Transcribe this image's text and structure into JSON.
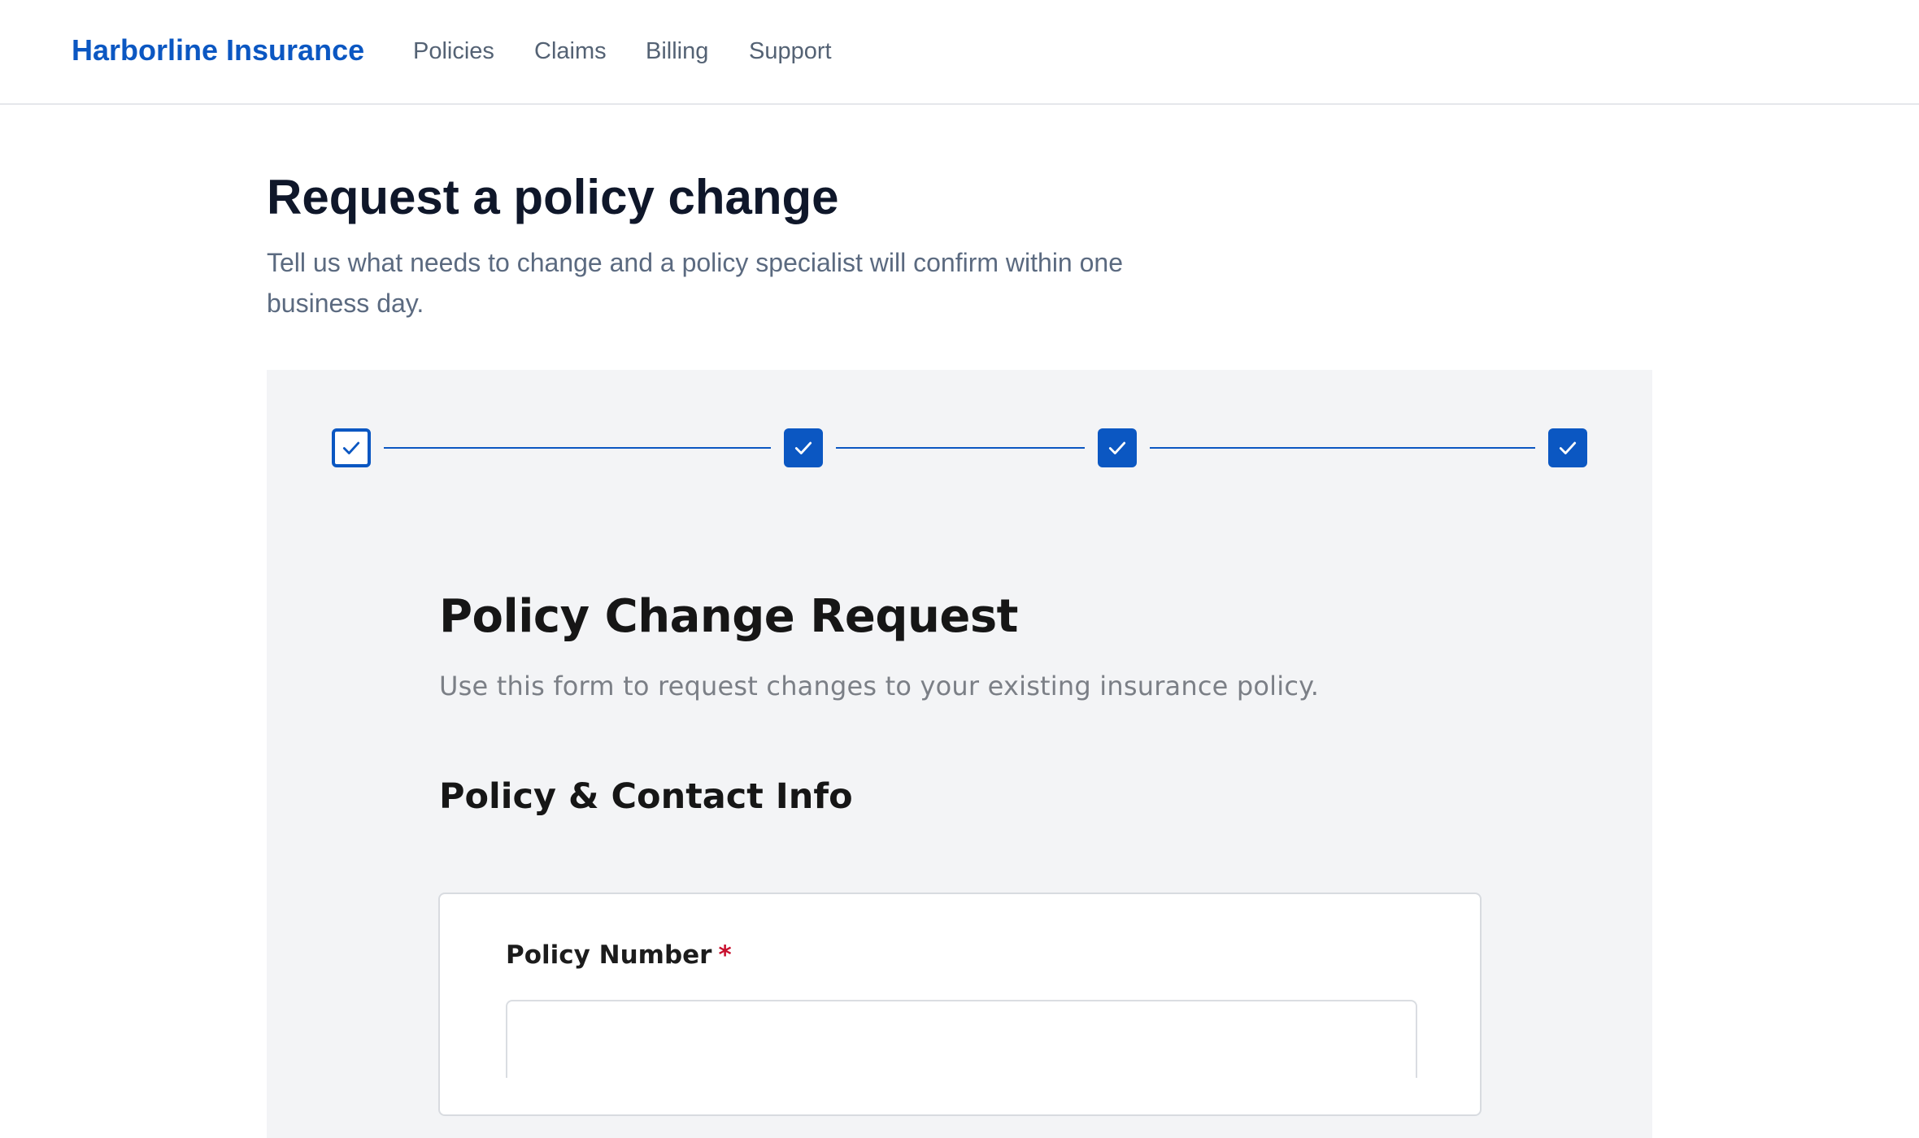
{
  "nav": {
    "brand": "Harborline Insurance",
    "links": [
      "Policies",
      "Claims",
      "Billing",
      "Support"
    ]
  },
  "page": {
    "title": "Request a policy change",
    "subtitle": "Tell us what needs to change and a policy specialist will confirm within one business day."
  },
  "stepper": {
    "steps_completed": 4,
    "steps_total": 4
  },
  "form": {
    "title": "Policy Change Request",
    "description": "Use this form to request changes to your existing insurance policy.",
    "section_title": "Policy & Contact Info",
    "fields": [
      {
        "label": "Policy Number",
        "required_mark": "*",
        "value": ""
      }
    ]
  },
  "colors": {
    "brand": "#0b57c2",
    "required": "#c8102e",
    "panel_bg": "#f3f4f6"
  }
}
